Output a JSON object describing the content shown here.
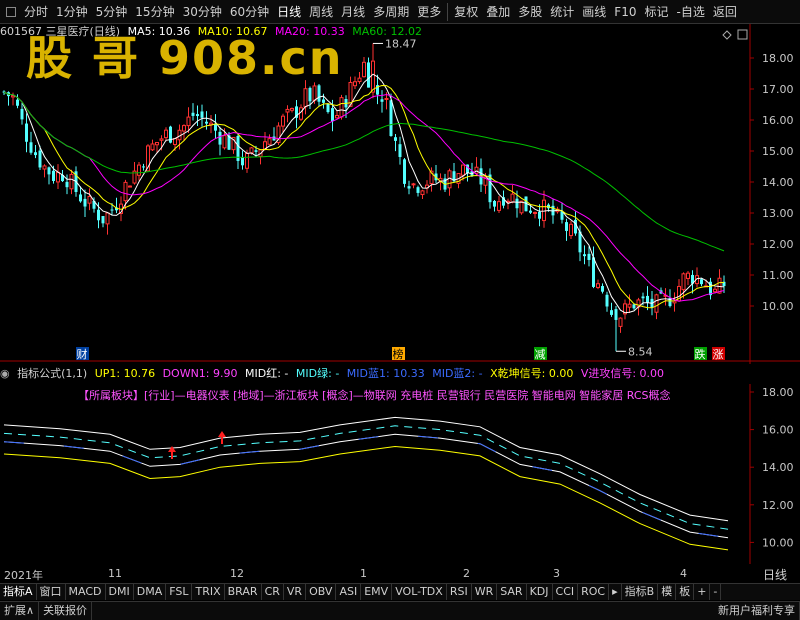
{
  "toolbar": {
    "periods": [
      "分时",
      "1分钟",
      "5分钟",
      "15分钟",
      "30分钟",
      "60分钟",
      "日线",
      "周线",
      "月线",
      "多周期",
      "更多"
    ],
    "actions": [
      "复权",
      "叠加",
      "多股",
      "统计",
      "画线",
      "F10",
      "标记",
      "-自选",
      "返回"
    ]
  },
  "watermark": "股 哥 908.cn",
  "main": {
    "stock": "601567 三星医疗(日线)",
    "ma5": "MA5: 10.36",
    "ma10": "MA10: 10.67",
    "ma20": "MA20: 10.33",
    "ma60": "MA60: 12.02",
    "high_label": "18.47",
    "low_label": "8.54",
    "price_levels": [
      "18.00",
      "17.00",
      "16.00",
      "15.00",
      "14.00",
      "13.00",
      "12.00",
      "11.00",
      "10.00"
    ],
    "events": [
      "财",
      "榜",
      "减",
      "跌",
      "涨"
    ],
    "colors": {
      "up": "#ff3232",
      "down": "#54ffff",
      "ma5": "#ffffff",
      "ma10": "#ffff00",
      "ma20": "#ff00ff",
      "ma60": "#00c000"
    }
  },
  "indicator": {
    "name": "指标公式(1,1)",
    "up1": "UP1: 10.76",
    "down1": "DOWN1: 9.90",
    "mid_red": "MID红: -",
    "mid_green": "MID绿: -",
    "mid_blue1": "MID蓝1: 10.33",
    "mid_blue2": "MID蓝2: -",
    "x_signal": "X乾坤信号: 0.00",
    "v_signal": "V进攻信号: 0.00",
    "sectors": "【所属板块】[行业]—电器仪表 [地域]—浙江板块 [概念]—物联网 充电桩 民营银行 民营医院 智能电网 智能家居 RCS概念",
    "price_levels": [
      "18.00",
      "16.00",
      "14.00",
      "12.00",
      "10.00"
    ]
  },
  "date_axis": [
    "2021年",
    "11",
    "12",
    "1",
    "2",
    "3",
    "4"
  ],
  "period_label": "日线",
  "tabs": [
    "指标A",
    "窗口",
    "MACD",
    "DMI",
    "DMA",
    "FSL",
    "TRIX",
    "BRAR",
    "CR",
    "VR",
    "OBV",
    "ASI",
    "EMV",
    "VOL-TDX",
    "RSI",
    "WR",
    "SAR",
    "KDJ",
    "CCI",
    "ROC",
    "▸",
    "指标B",
    "模",
    "板",
    "+",
    "-"
  ],
  "status": {
    "expand": "扩展∧",
    "related": "关联报价",
    "promo": "新用户福利专享"
  }
}
